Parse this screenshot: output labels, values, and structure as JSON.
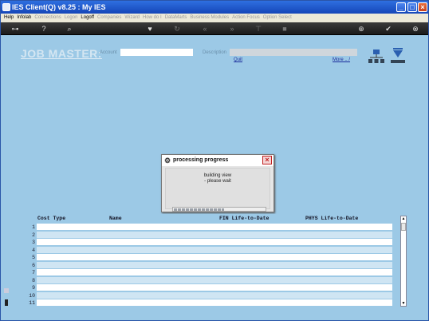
{
  "window": {
    "title": "IES Client(Q) v8.25 : My IES"
  },
  "menu": {
    "items": [
      {
        "label": "Help",
        "enabled": true
      },
      {
        "label": "Infolab",
        "enabled": true
      },
      {
        "label": "Connections",
        "enabled": false
      },
      {
        "label": "Logon",
        "enabled": false
      },
      {
        "label": "Logoff",
        "enabled": true
      },
      {
        "label": "Companies",
        "enabled": false
      },
      {
        "label": "Wizard",
        "enabled": false
      },
      {
        "label": "How do I",
        "enabled": false
      },
      {
        "label": "DataMarts",
        "enabled": false
      },
      {
        "label": "Business Modules",
        "enabled": false
      },
      {
        "label": "Action Focus",
        "enabled": false
      },
      {
        "label": "Option Select",
        "enabled": false
      }
    ]
  },
  "header": {
    "title": "JOB MASTER:",
    "account_label": "Account",
    "account_value": "",
    "description_label": "Description",
    "description_value": "",
    "quit_link": "Quit",
    "more_link": "More .. /"
  },
  "dialog": {
    "title": "processing progress",
    "message_line1": "building view",
    "message_line2": "- please wait",
    "progress": 0.55
  },
  "grid": {
    "columns": [
      "Cost Type",
      "Name",
      "FIN Life-to-Date",
      "PHYS Life-to-Date"
    ],
    "row_numbers": [
      "1",
      "2",
      "3",
      "4",
      "5",
      "6",
      "7",
      "8",
      "9",
      "10",
      "11"
    ]
  }
}
